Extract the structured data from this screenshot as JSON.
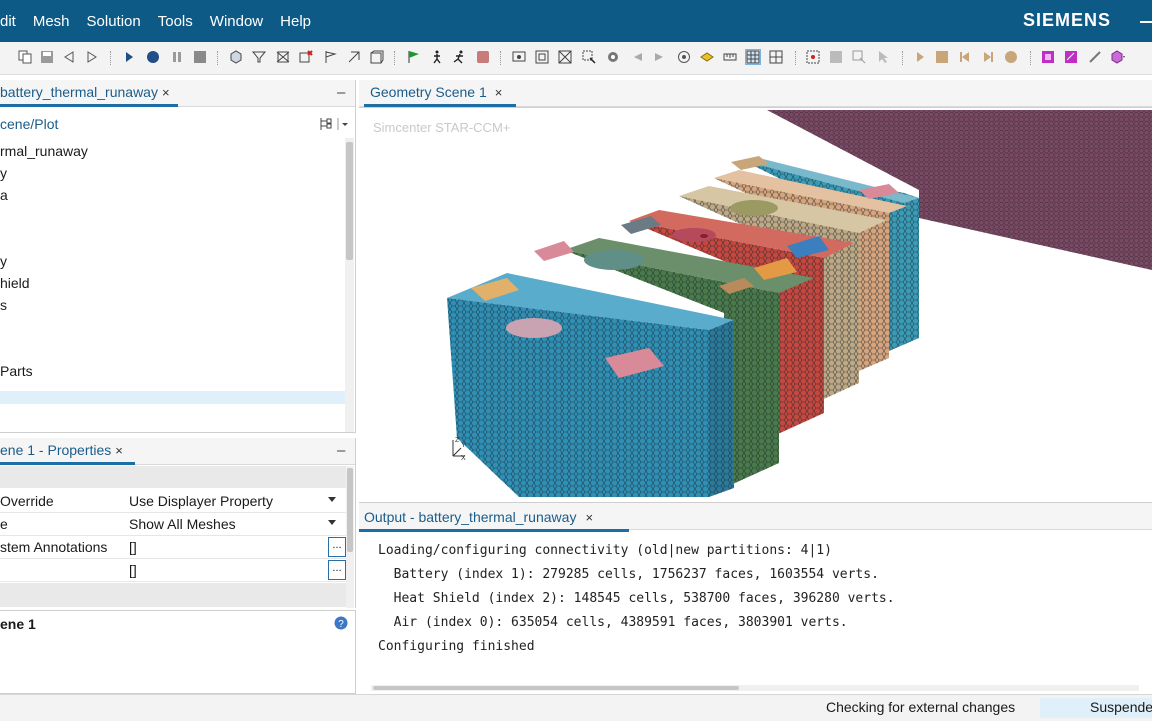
{
  "menubar": {
    "items": [
      "dit",
      "Mesh",
      "Solution",
      "Tools",
      "Window",
      "Help"
    ],
    "brand": "SIEMENS"
  },
  "colors": {
    "menubar_bg": "#0d5a87",
    "accent": "#1b6fa6",
    "mesh_blue": "#2f8fb5",
    "mesh_green": "#4a7a49",
    "mesh_red": "#c6473d",
    "mesh_tan": "#bfa884",
    "mesh_peach": "#d7a47c",
    "mesh_teal": "#3a9bb6",
    "heat_shield": "#7a4a63"
  },
  "toolbar": {
    "icons": [
      "copy-icon",
      "save-icon",
      "step-back-icon",
      "step-forward-icon",
      "run-icon",
      "record-icon",
      "pause-icon",
      "stop-icon",
      "mesh-icon",
      "filter-icon",
      "surface-icon",
      "delete-icon",
      "flag-icon",
      "part-icon",
      "volume-icon",
      "green-flag-icon",
      "walk-icon",
      "run-fast-icon",
      "stop-red-icon",
      "screenshot-icon",
      "fit-icon",
      "zoom-box-icon",
      "select-icon",
      "camera-icon",
      "arrow-left-icon",
      "arrow-right-icon",
      "sphere-icon",
      "plane-icon",
      "ruler-icon",
      "grid-icon",
      "grid-alt-icon",
      "axes-icon",
      "transform-icon",
      "select-region-icon",
      "pointer-icon",
      "play-icon",
      "stop-icon-2",
      "prev-frame-icon",
      "next-frame-icon",
      "record-icon-2",
      "magenta-box-icon",
      "magenta-box-icon-2",
      "brush-icon",
      "cube-dropdown-icon"
    ]
  },
  "tree_panel": {
    "tab": "battery_thermal_runaway",
    "header": "cene/Plot",
    "items": [
      "rmal_runaway",
      "y",
      "a",
      "y",
      "hield",
      "s",
      "Parts"
    ]
  },
  "props_panel": {
    "tab": "ene 1 - Properties",
    "rows": [
      {
        "key": "Override",
        "value": "Use Displayer Property",
        "control": "dropdown"
      },
      {
        "key": "e",
        "value": "Show All Meshes",
        "control": "dropdown"
      },
      {
        "key": "stem Annotations",
        "value": "[]",
        "control": "ellipsis"
      },
      {
        "key": "",
        "value": "[]",
        "control": "ellipsis"
      }
    ]
  },
  "desc_panel": {
    "title": "ene 1"
  },
  "scene_panel": {
    "tab": "Geometry Scene 1",
    "watermark": "Simcenter STAR-CCM+"
  },
  "output_panel": {
    "tab": "Output - battery_thermal_runaway",
    "lines": [
      "Loading/configuring connectivity (old|new partitions: 4|1)",
      "  Battery (index 1): 279285 cells, 1756237 faces, 1603554 verts.",
      "  Heat Shield (index 2): 148545 cells, 538700 faces, 396280 verts.",
      "  Air (index 0): 635054 cells, 4389591 faces, 3803901 verts.",
      "Configuring finished"
    ]
  },
  "statusbar": {
    "message": "Checking for external changes",
    "state": "Suspende"
  }
}
